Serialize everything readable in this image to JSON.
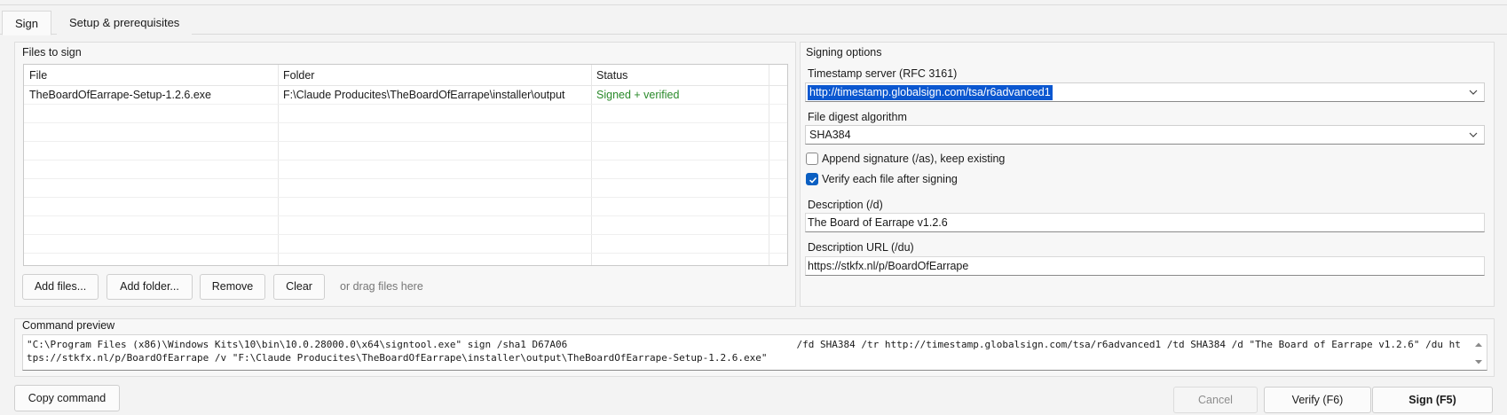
{
  "tabs": [
    {
      "label": "Sign",
      "active": true
    },
    {
      "label": "Setup & prerequisites",
      "active": false
    }
  ],
  "files_group": {
    "title": "Files to sign",
    "columns": [
      "File",
      "Folder",
      "Status"
    ],
    "rows": [
      {
        "file": "TheBoardOfEarrape-Setup-1.2.6.exe",
        "folder": "F:\\Claude Producites\\TheBoardOfEarrape\\installer\\output",
        "status": "Signed + verified"
      }
    ],
    "buttons": {
      "add_files": "Add files...",
      "add_folder": "Add folder...",
      "remove": "Remove",
      "clear": "Clear"
    },
    "drag_hint": "or drag files here"
  },
  "signing_options": {
    "title": "Signing options",
    "timestamp_label": "Timestamp server (RFC 3161)",
    "timestamp_value": "http://timestamp.globalsign.com/tsa/r6advanced1",
    "digest_label": "File digest algorithm",
    "digest_value": "SHA384",
    "append_label": "Append signature (/as), keep existing",
    "append_checked": false,
    "verify_label": "Verify each file after signing",
    "verify_checked": true,
    "description_label": "Description (/d)",
    "description_value": "The Board of Earrape v1.2.6",
    "description_url_label": "Description URL (/du)",
    "description_url_value": "https://stkfx.nl/p/BoardOfEarrape"
  },
  "command_preview": {
    "title": "Command preview",
    "text": "\"C:\\Program Files (x86)\\Windows Kits\\10\\bin\\10.0.28000.0\\x64\\signtool.exe\" sign /sha1 D67A06                                       /fd SHA384 /tr http://timestamp.globalsign.com/tsa/r6advanced1 /td SHA384 /d \"The Board of Earrape v1.2.6\" /du https://stkfx.nl/p/BoardOfEarrape /v \"F:\\Claude Producites\\TheBoardOfEarrape\\installer\\output\\TheBoardOfEarrape-Setup-1.2.6.exe\""
  },
  "bottom_buttons": {
    "copy_command": "Copy command",
    "cancel": "Cancel",
    "verify": "Verify (F6)",
    "sign": "Sign (F5)"
  },
  "colors": {
    "accent": "#0b5fc2",
    "status_ok": "#2a8a2a",
    "selection": "#0b57d0"
  }
}
